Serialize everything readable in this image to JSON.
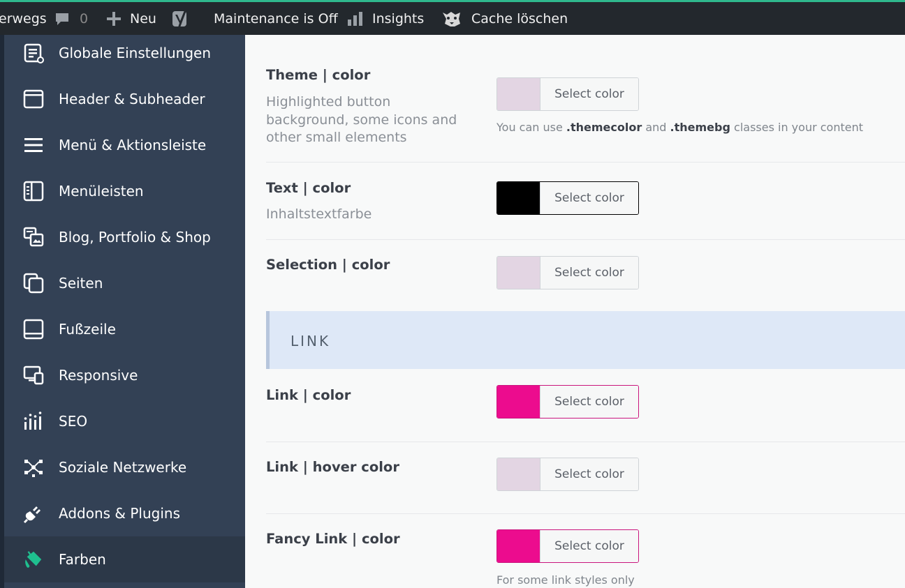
{
  "adminbar": {
    "site_fragment": "erwegs",
    "comments_count": "0",
    "new_label": "Neu",
    "maintenance_label": "Maintenance is Off",
    "insights_label": "Insights",
    "cache_label": "Cache löschen"
  },
  "sidebar": {
    "items": [
      {
        "label": "Globale Einstellungen",
        "icon": "settings-doc-icon"
      },
      {
        "label": "Header & Subheader",
        "icon": "window-icon"
      },
      {
        "label": "Menü & Aktionsleiste",
        "icon": "hamburger-icon"
      },
      {
        "label": "Menüleisten",
        "icon": "sidebar-layout-icon"
      },
      {
        "label": "Blog, Portfolio & Shop",
        "icon": "blog-portfolio-icon"
      },
      {
        "label": "Seiten",
        "icon": "pages-icon"
      },
      {
        "label": "Fußzeile",
        "icon": "footer-icon"
      },
      {
        "label": "Responsive",
        "icon": "responsive-devices-icon"
      },
      {
        "label": "SEO",
        "icon": "seo-bars-icon"
      },
      {
        "label": "Soziale Netzwerke",
        "icon": "social-network-icon"
      },
      {
        "label": "Addons & Plugins",
        "icon": "plug-icon"
      },
      {
        "label": "Farben",
        "icon": "paint-bucket-icon",
        "active": true
      }
    ]
  },
  "colors": {
    "accent_green": "#2fb88d",
    "sidebar_bg": "#334155",
    "theme_color": "#e3d5e3",
    "text_color": "#000000",
    "selection_color": "#e3d5e3",
    "link_color": "#ec0c8e",
    "link_hover_color": "#e3d5e3",
    "fancy_link_color": "#ec0c8e"
  },
  "options": {
    "theme": {
      "title": "Theme | color",
      "desc": "Highlighted button background, some icons and other small elements",
      "button": "Select color"
    },
    "theme_note": {
      "prefix": "You can use ",
      "class1": ".themecolor",
      "mid": " and ",
      "class2": ".themebg",
      "suffix": " classes in your content"
    },
    "text": {
      "title": "Text | color",
      "desc": "Inhaltstextfarbe",
      "button": "Select color"
    },
    "selection": {
      "title": "Selection | color",
      "button": "Select color"
    },
    "section_link": "LINK",
    "link": {
      "title": "Link | color",
      "button": "Select color"
    },
    "link_hover": {
      "title": "Link | hover color",
      "button": "Select color"
    },
    "fancy_link": {
      "title": "Fancy Link | color",
      "button": "Select color",
      "note": "For some link styles only"
    }
  }
}
